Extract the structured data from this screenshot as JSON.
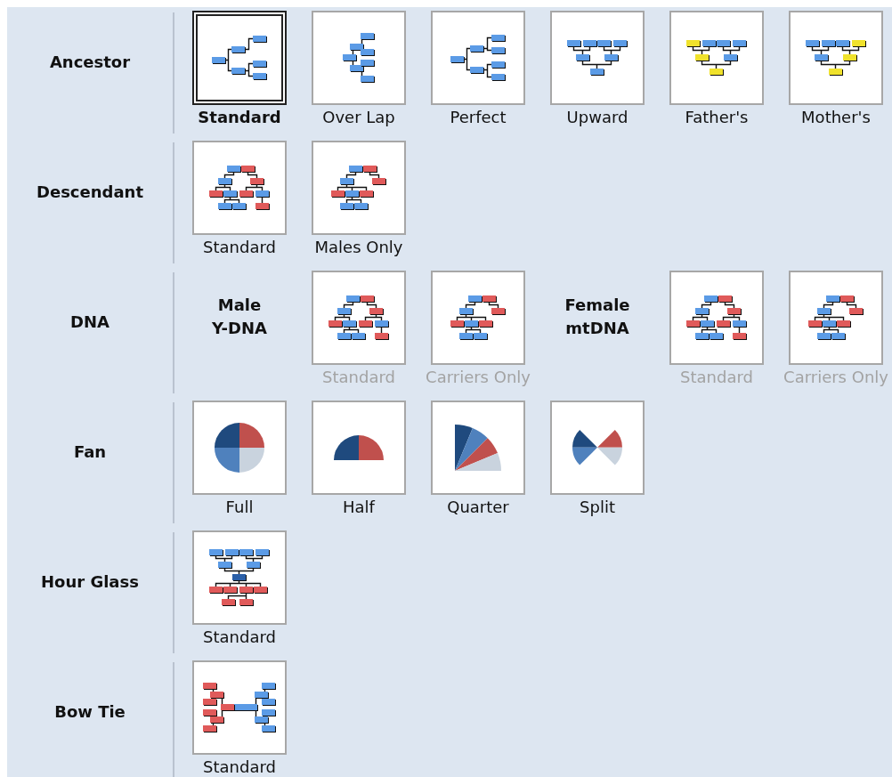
{
  "groups": [
    {
      "label": "Ancestor",
      "items": [
        {
          "kind": "tile",
          "caption": "Standard",
          "selected": true,
          "disabled": false
        },
        {
          "kind": "tile",
          "caption": "Over Lap",
          "selected": false,
          "disabled": false
        },
        {
          "kind": "tile",
          "caption": "Perfect",
          "selected": false,
          "disabled": false
        },
        {
          "kind": "tile",
          "caption": "Upward",
          "selected": false,
          "disabled": false
        },
        {
          "kind": "tile",
          "caption": "Father's",
          "selected": false,
          "disabled": false
        },
        {
          "kind": "tile",
          "caption": "Mother's",
          "selected": false,
          "disabled": false
        }
      ]
    },
    {
      "label": "Descendant",
      "items": [
        {
          "kind": "tile",
          "caption": "Standard",
          "selected": false,
          "disabled": false
        },
        {
          "kind": "tile",
          "caption": "Males Only",
          "selected": false,
          "disabled": false
        }
      ]
    },
    {
      "label": "DNA",
      "items": [
        {
          "kind": "heading",
          "caption": "Male Y-DNA"
        },
        {
          "kind": "tile",
          "caption": "Standard",
          "selected": false,
          "disabled": true
        },
        {
          "kind": "tile",
          "caption": "Carriers Only",
          "selected": false,
          "disabled": true
        },
        {
          "kind": "heading",
          "caption": "Female mtDNA"
        },
        {
          "kind": "tile",
          "caption": "Standard",
          "selected": false,
          "disabled": true
        },
        {
          "kind": "tile",
          "caption": "Carriers Only",
          "selected": false,
          "disabled": true
        }
      ]
    },
    {
      "label": "Fan",
      "items": [
        {
          "kind": "tile",
          "caption": "Full",
          "selected": false,
          "disabled": false
        },
        {
          "kind": "tile",
          "caption": "Half",
          "selected": false,
          "disabled": false
        },
        {
          "kind": "tile",
          "caption": "Quarter",
          "selected": false,
          "disabled": false
        },
        {
          "kind": "tile",
          "caption": "Split",
          "selected": false,
          "disabled": false
        }
      ]
    },
    {
      "label": "Hour Glass",
      "items": [
        {
          "kind": "tile",
          "caption": "Standard",
          "selected": false,
          "disabled": false
        }
      ]
    },
    {
      "label": "Bow Tie",
      "items": [
        {
          "kind": "tile",
          "caption": "Standard",
          "selected": false,
          "disabled": false
        }
      ]
    }
  ]
}
